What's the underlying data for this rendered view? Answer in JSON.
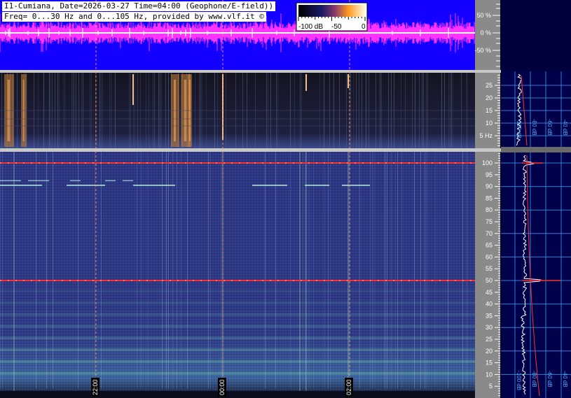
{
  "header": {
    "line1": "I1-Cumiana, Date=2026-03-27 Time=04:00 (Geophone/E-field))",
    "line2": "Freq= 0...30 Hz and 0...105 Hz, provided by www.vlf.it ©"
  },
  "colorbar": {
    "labels": [
      "-100 dB",
      "-50",
      "0"
    ]
  },
  "colors": {
    "waveform_bg": "#1400ff",
    "waveform_trace": "#ff33ff",
    "spectrogram_low_bg": "#12121c",
    "spectrogram_high_bg": "#2a3478",
    "axis_panel": "#8a8a8a",
    "profile_bg": "#00004a",
    "cursor_line": "#ff9966",
    "grid_line": "#3fa9ff"
  },
  "chart_data": [
    {
      "type": "line",
      "panel": "waveform",
      "y_ticks": [
        "50 %",
        "0 %",
        "-50 %"
      ],
      "ylim": [
        -100,
        100
      ]
    },
    {
      "type": "heatmap",
      "panel": "spectrogram 0-30 Hz",
      "y_ticks": [
        "25",
        "20",
        "15",
        "10",
        "5 Hz"
      ],
      "ylim": [
        0,
        30
      ]
    },
    {
      "type": "heatmap",
      "panel": "spectrogram 0-105 Hz",
      "y_ticks": [
        "100",
        "95",
        "90",
        "85",
        "80",
        "75",
        "70",
        "65",
        "60",
        "55",
        "50",
        "45",
        "40",
        "35",
        "30",
        "25",
        "20",
        "15",
        "10",
        "5"
      ],
      "ylim": [
        0,
        105
      ],
      "time_markers": [
        "22:00",
        "00:00",
        "02:00"
      ],
      "persistent_lines_hz": [
        50,
        100
      ]
    },
    {
      "type": "line",
      "panel": "spectrum profiles",
      "x_ticks": [
        "-100 dB",
        "-80 dB",
        "-60 dB",
        "-40 dB",
        "-20 dB"
      ]
    }
  ]
}
